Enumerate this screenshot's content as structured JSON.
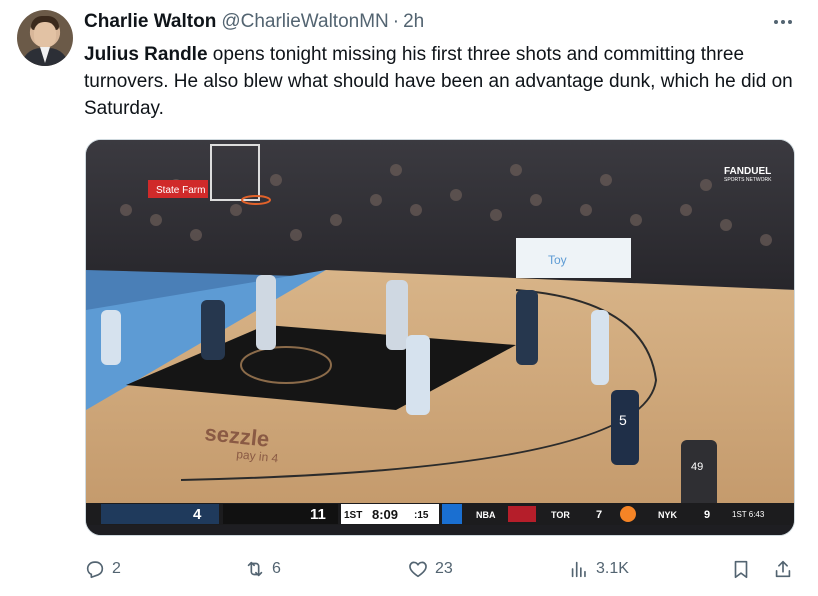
{
  "author": {
    "name": "Charlie Walton",
    "handle": "@CharlieWaltonMN",
    "separator": "·",
    "time": "2h"
  },
  "tweet": {
    "bold_lead": "Julius Randle",
    "body": " opens tonight missing his first three shots and committing three turnovers. He also blew what should have been an advantage dunk, which he did on Saturday."
  },
  "media": {
    "arena_sponsor": "State Farm",
    "broadcaster": "FANDUEL",
    "broadcaster_sub": "SPORTS NETWORK",
    "court_sponsor": "sezzle",
    "court_sponsor_tag": "pay in 4",
    "player_numbers": [
      "5",
      "49"
    ],
    "scorebug": {
      "home_score": "4",
      "away_score": "11",
      "period": "1ST",
      "clock": "8:09",
      "shot_clock": ":15",
      "league": "NBA",
      "other_game_team1": "TOR",
      "other_game_score1": "7",
      "other_game_team2": "NYK",
      "other_game_score2": "9",
      "other_game_status": "1ST 6:43"
    }
  },
  "actions": {
    "reply_count": "2",
    "retweet_count": "6",
    "like_count": "23",
    "views_count": "3.1K"
  },
  "icons": {
    "reply": "reply-icon",
    "retweet": "retweet-icon",
    "like": "heart-icon",
    "views": "views-icon",
    "bookmark": "bookmark-icon",
    "share": "share-icon",
    "more": "more-icon"
  },
  "colors": {
    "text": "#0f1419",
    "secondary": "#536471",
    "court_wood": "#c9a57a",
    "court_paint": "#151515",
    "court_blue": "#5d9bd4"
  }
}
